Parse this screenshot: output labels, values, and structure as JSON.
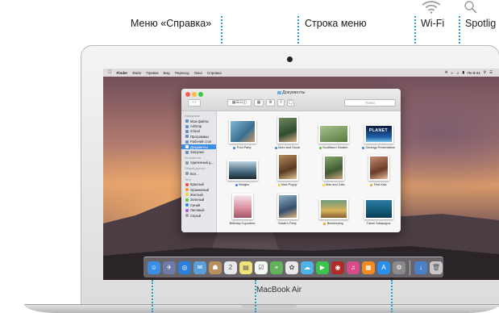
{
  "callouts": {
    "help_menu": "Меню «Справка»",
    "menu_bar": "Строка меню",
    "wifi": "Wi-Fi",
    "spotlight": "Spotlig"
  },
  "model_label": "MacBook Air",
  "menubar": {
    "app_name": "Finder",
    "items": [
      "Файл",
      "Правка",
      "Вид",
      "Переход",
      "Окно",
      "Справка"
    ],
    "clock": "Пн 9:41"
  },
  "finder": {
    "title": "Документы",
    "search_placeholder": "Поиск",
    "sidebar": {
      "favorites_header": "Избранное",
      "favorites": [
        "Мои файлы",
        "AirDrop",
        "iCloud",
        "Программы",
        "Рабочий стол",
        "Документы",
        "Загрузки"
      ],
      "selected": "Документы",
      "devices_header": "Устройства",
      "devices": [
        "Удаленный д..."
      ],
      "shared_header": "Общий доступ",
      "shared": [
        "Все..."
      ],
      "tags_header": "Теги",
      "tags": [
        {
          "name": "Красный",
          "color": "#e84c3d"
        },
        {
          "name": "Оранжевый",
          "color": "#f39a2b"
        },
        {
          "name": "Желтый",
          "color": "#f2d22e"
        },
        {
          "name": "Зеленый",
          "color": "#5ec13a"
        },
        {
          "name": "Синий",
          "color": "#3a82e8"
        },
        {
          "name": "Лиловый",
          "color": "#a35bd4"
        },
        {
          "name": "Серый",
          "color": "#9a9a9a"
        }
      ]
    },
    "files": [
      {
        "name": "Pool Party",
        "tag": "#3a82e8"
      },
      {
        "name": "Mom and Oscar",
        "tag": "#3a82e8"
      },
      {
        "name": "Southburn Garden",
        "tag": "#5ec13a"
      },
      {
        "name": "Geology Presentation",
        "tag": "#3a82e8"
      },
      {
        "name": "Bridges",
        "tag": "#3a82e8"
      },
      {
        "name": "New Puppy",
        "tag": "#f2d22e"
      },
      {
        "name": "Max and Julia",
        "tag": "#f2d22e"
      },
      {
        "name": "First Kiss",
        "tag": "#f39a2b"
      },
      {
        "name": "Birthday Cupcakes",
        "tag": ""
      },
      {
        "name": "Sarah's Party",
        "tag": ""
      },
      {
        "name": "Beekeeping",
        "tag": "#f39a2b"
      },
      {
        "name": "Travel Galapagos",
        "tag": ""
      }
    ],
    "planet_text": "PLANET"
  },
  "dock_icons": [
    "finder-icon",
    "launchpad-icon",
    "safari-icon",
    "mail-icon",
    "contacts-icon",
    "calendar-icon",
    "notes-icon",
    "reminders-icon",
    "maps-icon",
    "photos-icon",
    "messages-icon",
    "facetime-icon",
    "photo-booth-icon",
    "itunes-icon",
    "ibooks-icon",
    "app-store-icon",
    "system-preferences-icon",
    "downloads-stack-icon",
    "trash-icon"
  ],
  "colors": {
    "accent": "#2a9fd6",
    "selection": "#3b8de6"
  }
}
